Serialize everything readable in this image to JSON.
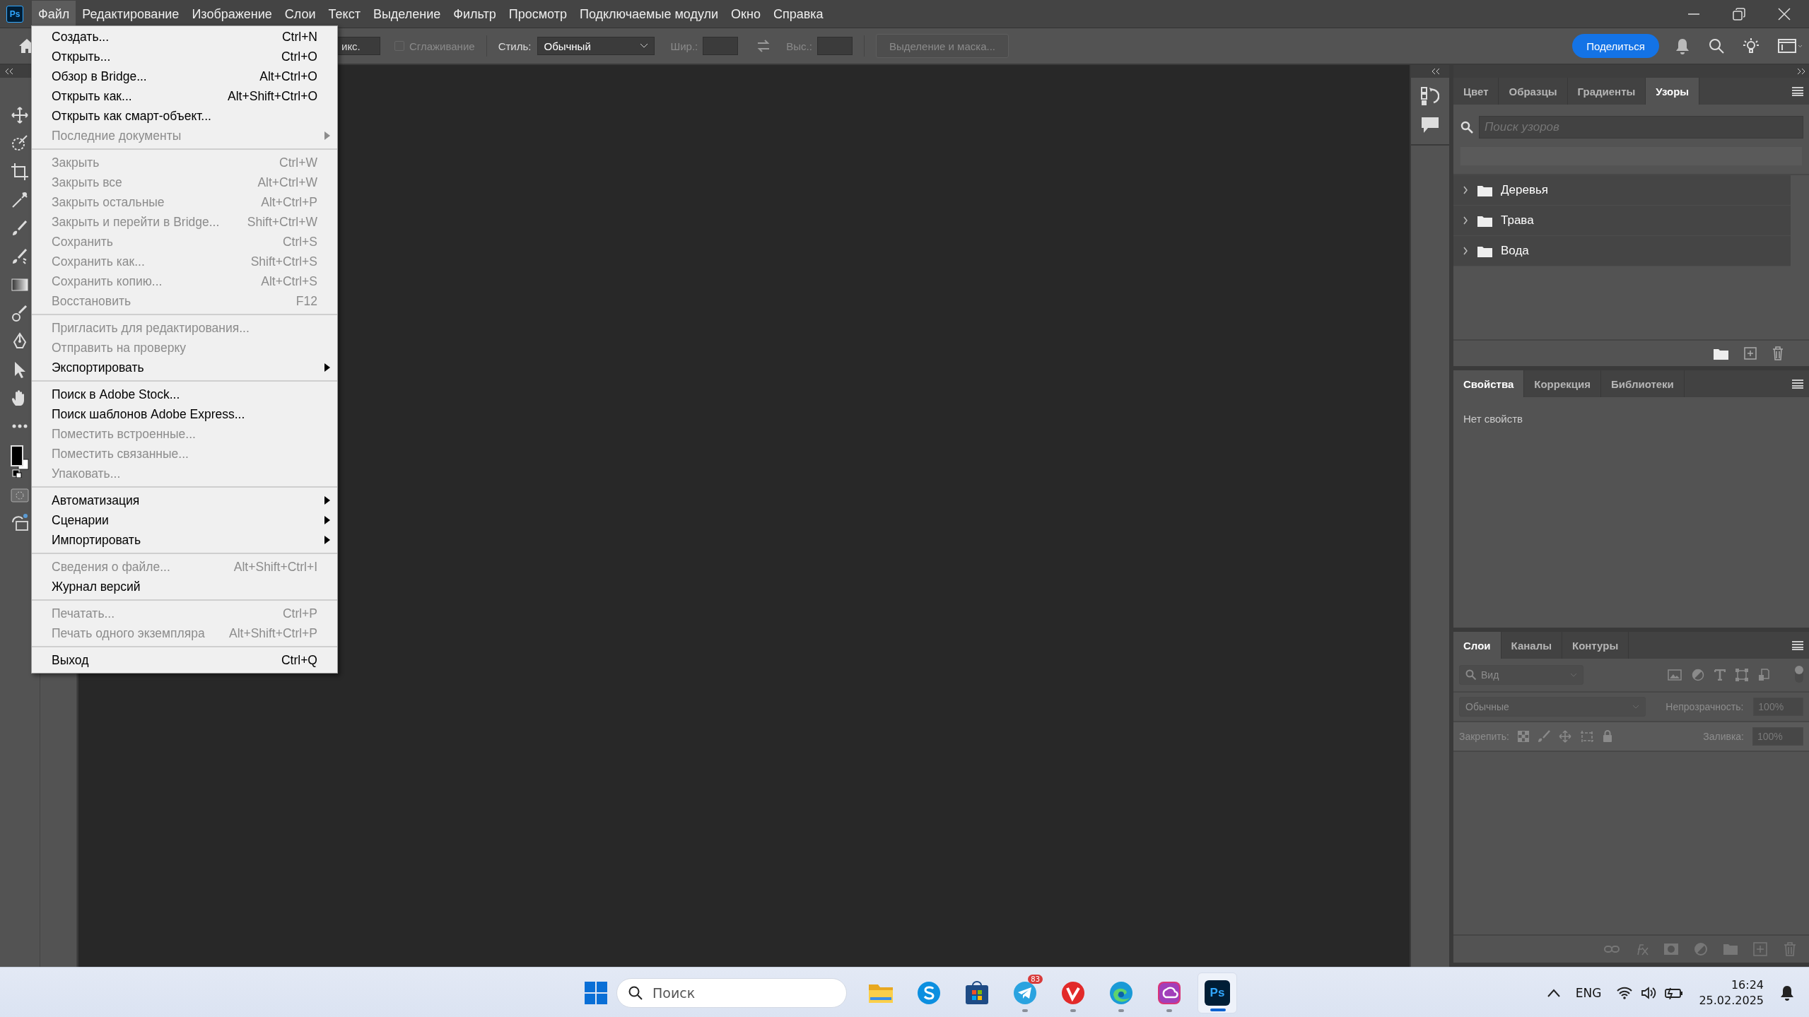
{
  "app": {
    "icon_label": "Ps"
  },
  "menu_bar": [
    {
      "label": "Файл",
      "selected": true
    },
    {
      "label": "Редактирование",
      "selected": false
    },
    {
      "label": "Изображение",
      "selected": false
    },
    {
      "label": "Слои",
      "selected": false
    },
    {
      "label": "Текст",
      "selected": false
    },
    {
      "label": "Выделение",
      "selected": false
    },
    {
      "label": "Фильтр",
      "selected": false
    },
    {
      "label": "Просмотр",
      "selected": false
    },
    {
      "label": "Подключаемые модули",
      "selected": false
    },
    {
      "label": "Окно",
      "selected": false
    },
    {
      "label": "Справка",
      "selected": false
    }
  ],
  "options_bar": {
    "size_field": "икс.",
    "antialias": {
      "label": "Сглаживание",
      "checked": false,
      "disabled": true
    },
    "style_label": "Стиль:",
    "style_value": "Обычный",
    "width_label": "Шир.:",
    "height_label": "Выс.:",
    "mask_button": "Выделение и маска...",
    "share_button": "Поделиться"
  },
  "file_menu": [
    {
      "kind": "item",
      "label": "Создать...",
      "shortcut": "Ctrl+N",
      "disabled": false,
      "submenu": false
    },
    {
      "kind": "item",
      "label": "Открыть...",
      "shortcut": "Ctrl+O",
      "disabled": false,
      "submenu": false
    },
    {
      "kind": "item",
      "label": "Обзор в Bridge...",
      "shortcut": "Alt+Ctrl+O",
      "disabled": false,
      "submenu": false
    },
    {
      "kind": "item",
      "label": "Открыть как...",
      "shortcut": "Alt+Shift+Ctrl+O",
      "disabled": false,
      "submenu": false
    },
    {
      "kind": "item",
      "label": "Открыть как смарт-объект...",
      "disabled": false,
      "submenu": false
    },
    {
      "kind": "item",
      "label": "Последние документы",
      "disabled": true,
      "submenu": true
    },
    {
      "kind": "separator"
    },
    {
      "kind": "item",
      "label": "Закрыть",
      "shortcut": "Ctrl+W",
      "disabled": true,
      "submenu": false
    },
    {
      "kind": "item",
      "label": "Закрыть все",
      "shortcut": "Alt+Ctrl+W",
      "disabled": true,
      "submenu": false
    },
    {
      "kind": "item",
      "label": "Закрыть остальные",
      "shortcut": "Alt+Ctrl+P",
      "disabled": true,
      "submenu": false
    },
    {
      "kind": "item",
      "label": "Закрыть и перейти в Bridge...",
      "shortcut": "Shift+Ctrl+W",
      "disabled": true,
      "submenu": false
    },
    {
      "kind": "item",
      "label": "Сохранить",
      "shortcut": "Ctrl+S",
      "disabled": true,
      "submenu": false
    },
    {
      "kind": "item",
      "label": "Сохранить как...",
      "shortcut": "Shift+Ctrl+S",
      "disabled": true,
      "submenu": false
    },
    {
      "kind": "item",
      "label": "Сохранить копию...",
      "shortcut": "Alt+Ctrl+S",
      "disabled": true,
      "submenu": false
    },
    {
      "kind": "item",
      "label": "Восстановить",
      "shortcut": "F12",
      "disabled": true,
      "submenu": false
    },
    {
      "kind": "separator"
    },
    {
      "kind": "item",
      "label": "Пригласить для редактирования...",
      "disabled": true,
      "submenu": false
    },
    {
      "kind": "item",
      "label": "Отправить на проверку",
      "disabled": true,
      "submenu": false
    },
    {
      "kind": "item",
      "label": "Экспортировать",
      "disabled": false,
      "submenu": true
    },
    {
      "kind": "separator"
    },
    {
      "kind": "item",
      "label": "Поиск в Adobe Stock...",
      "disabled": false,
      "submenu": false
    },
    {
      "kind": "item",
      "label": "Поиск шаблонов Adobe Express...",
      "disabled": false,
      "submenu": false
    },
    {
      "kind": "item",
      "label": "Поместить встроенные...",
      "disabled": true,
      "submenu": false
    },
    {
      "kind": "item",
      "label": "Поместить связанные...",
      "disabled": true,
      "submenu": false
    },
    {
      "kind": "item",
      "label": "Упаковать...",
      "disabled": true,
      "submenu": false
    },
    {
      "kind": "separator"
    },
    {
      "kind": "item",
      "label": "Автоматизация",
      "disabled": false,
      "submenu": true
    },
    {
      "kind": "item",
      "label": "Сценарии",
      "disabled": false,
      "submenu": true
    },
    {
      "kind": "item",
      "label": "Импортировать",
      "disabled": false,
      "submenu": true
    },
    {
      "kind": "separator"
    },
    {
      "kind": "item",
      "label": "Сведения о файле...",
      "shortcut": "Alt+Shift+Ctrl+I",
      "disabled": true,
      "submenu": false
    },
    {
      "kind": "item",
      "label": "Журнал версий",
      "disabled": false,
      "submenu": false
    },
    {
      "kind": "separator"
    },
    {
      "kind": "item",
      "label": "Печатать...",
      "shortcut": "Ctrl+P",
      "disabled": true,
      "submenu": false
    },
    {
      "kind": "item",
      "label": "Печать одного экземпляра",
      "shortcut": "Alt+Shift+Ctrl+P",
      "disabled": true,
      "submenu": false
    },
    {
      "kind": "separator"
    },
    {
      "kind": "item",
      "label": "Выход",
      "shortcut": "Ctrl+Q",
      "disabled": false,
      "submenu": false
    }
  ],
  "patterns_panel": {
    "tabs": [
      {
        "label": "Цвет",
        "selected": false
      },
      {
        "label": "Образцы",
        "selected": false
      },
      {
        "label": "Градиенты",
        "selected": false
      },
      {
        "label": "Узоры",
        "selected": true
      }
    ],
    "search_placeholder": "Поиск узоров",
    "folders": [
      {
        "name": "Деревья",
        "expanded": false
      },
      {
        "name": "Трава",
        "expanded": false
      },
      {
        "name": "Вода",
        "expanded": false
      }
    ]
  },
  "properties_panel": {
    "tabs": [
      {
        "label": "Свойства",
        "selected": true
      },
      {
        "label": "Коррекция",
        "selected": false
      },
      {
        "label": "Библиотеки",
        "selected": false
      }
    ],
    "empty_text": "Нет свойств"
  },
  "layers_panel": {
    "tabs": [
      {
        "label": "Слои",
        "selected": true
      },
      {
        "label": "Каналы",
        "selected": false
      },
      {
        "label": "Контуры",
        "selected": false
      }
    ],
    "filter_placeholder": "Вид",
    "blend_mode": "Обычные",
    "opacity_label": "Непрозрачность:",
    "opacity_value": "100%",
    "lock_label": "Закрепить:",
    "fill_label": "Заливка:",
    "fill_value": "100%"
  },
  "taskbar": {
    "search_placeholder": "Поиск",
    "apps": [
      {
        "kind": "files",
        "running": false,
        "active": false
      },
      {
        "kind": "skype",
        "running": false,
        "active": false
      },
      {
        "kind": "store",
        "running": false,
        "active": false
      },
      {
        "kind": "telegram",
        "badge": "83",
        "running": true,
        "active": false
      },
      {
        "kind": "vivaldi",
        "running": true,
        "active": false
      },
      {
        "kind": "edge",
        "running": true,
        "active": false
      },
      {
        "kind": "creative",
        "running": true,
        "active": false
      },
      {
        "kind": "photoshop",
        "label": "Ps",
        "running": true,
        "active": true
      }
    ],
    "language": "ENG",
    "time": "16:24",
    "date": "25.02.2025"
  }
}
